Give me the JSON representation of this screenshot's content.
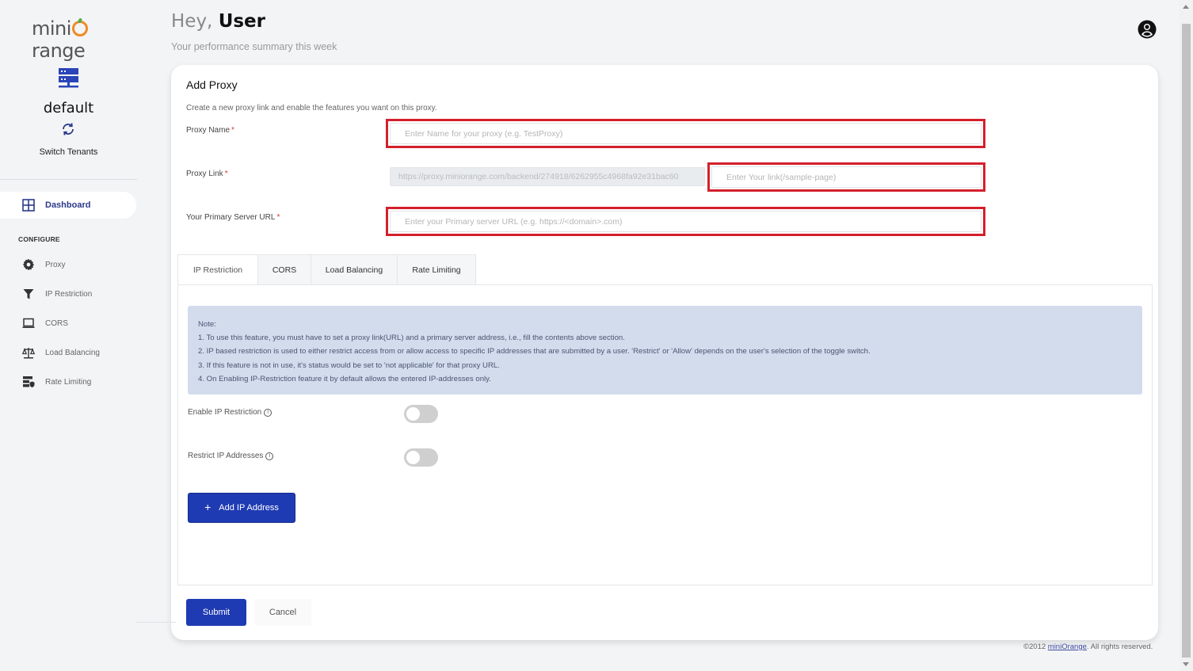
{
  "brand": {
    "logo_prefix": "mini",
    "logo_suffix": "range"
  },
  "sidebar": {
    "tenant_name": "default",
    "switch_label": "Switch Tenants",
    "dashboard_label": "Dashboard",
    "section_title": "CONFIGURE",
    "items": [
      {
        "label": "Proxy",
        "icon": "gear-icon"
      },
      {
        "label": "IP Restriction",
        "icon": "filter-icon"
      },
      {
        "label": "CORS",
        "icon": "laptop-icon"
      },
      {
        "label": "Load Balancing",
        "icon": "scale-icon"
      },
      {
        "label": "Rate Limiting",
        "icon": "server-shield-icon"
      }
    ]
  },
  "header": {
    "greeting": "Hey,",
    "user": "User",
    "subtitle": "Your performance summary this week"
  },
  "form": {
    "title": "Add Proxy",
    "description": "Create a new proxy link and enable the features you want on this proxy.",
    "proxy_name": {
      "label": "Proxy Name",
      "required_mark": "*",
      "placeholder": "Enter Name for your proxy (e.g. TestProxy)",
      "value": ""
    },
    "proxy_link": {
      "label": "Proxy Link",
      "required_mark": "*",
      "prefix_value": "https://proxy.miniorange.com/backend/274918/6262955c4968fa92e31bac60",
      "placeholder": "Enter Your link(/sample-page)",
      "value": ""
    },
    "primary_url": {
      "label": "Your Primary Server URL",
      "required_mark": "*",
      "placeholder": "Enter your Primary server URL (e.g. https://<domain>.com)",
      "value": ""
    }
  },
  "tabs": [
    {
      "label": "IP Restriction",
      "active": true
    },
    {
      "label": "CORS",
      "active": false
    },
    {
      "label": "Load Balancing",
      "active": false
    },
    {
      "label": "Rate Limiting",
      "active": false
    }
  ],
  "ip_restriction": {
    "note_title": "Note:",
    "notes": [
      "1. To use this feature, you must have to set a proxy link(URL) and a primary server address, i.e., fill the contents above section.",
      "2. IP based restriction is used to either restrict access from or allow access to specific IP addresses that are submitted by a user. 'Restrict' or 'Allow' depends on the user's selection of the toggle switch.",
      "3. If this feature is not in use, it's status would be set to 'not applicable' for that proxy URL.",
      "4. On Enabling IP-Restriction feature it by default allows the entered IP-addresses only."
    ],
    "enable_label": "Enable IP Restriction",
    "enable_on": false,
    "restrict_label": "Restrict IP Addresses",
    "restrict_on": false,
    "info_glyph": "i",
    "add_button_icon": "+",
    "add_button_label": "Add IP Address"
  },
  "actions": {
    "submit": "Submit",
    "cancel": "Cancel"
  },
  "footer": {
    "copyright": "©2012",
    "link_text": "miniOrange",
    "rights": ". All rights reserved."
  },
  "colors": {
    "primary": "#1f3bb3",
    "highlight": "#d4202c",
    "note_bg": "#d3dced",
    "brand_orange": "#f08a24"
  }
}
